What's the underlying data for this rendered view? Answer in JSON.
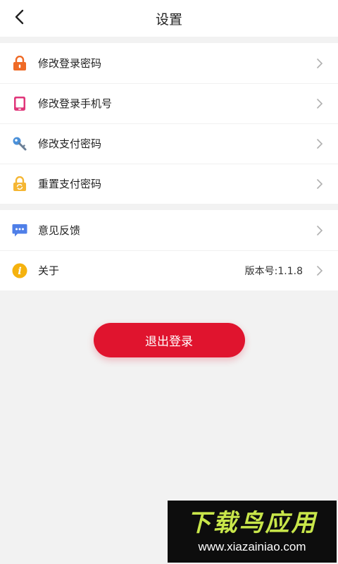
{
  "header": {
    "title": "设置"
  },
  "menu_group_1": [
    {
      "label": "修改登录密码",
      "icon": "lock-icon",
      "icon_color": "#ef6a26"
    },
    {
      "label": "修改登录手机号",
      "icon": "phone-icon",
      "icon_color": "#e0367a"
    },
    {
      "label": "修改支付密码",
      "icon": "key-icon",
      "icon_color": "#4a90d9"
    },
    {
      "label": "重置支付密码",
      "icon": "refresh-lock-icon",
      "icon_color": "#f5b633"
    }
  ],
  "menu_group_2": [
    {
      "label": "意见反馈",
      "icon": "message-icon",
      "icon_color": "#4f7fe8"
    },
    {
      "label": "关于",
      "value": "版本号:1.1.8",
      "icon": "info-icon",
      "icon_color": "#f5b20e"
    }
  ],
  "logout": {
    "label": "退出登录",
    "color": "#e0142e"
  },
  "watermark": {
    "title": "下载鸟应用",
    "url": "www.xiazainiao.com"
  }
}
